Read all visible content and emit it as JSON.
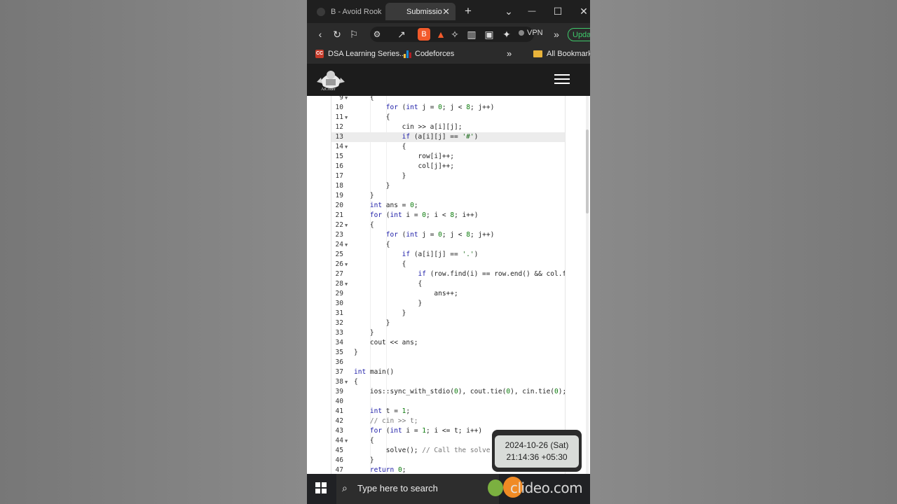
{
  "browser": {
    "tabs": [
      {
        "label": "B - Avoid Rook"
      },
      {
        "label": "Submissio"
      }
    ],
    "tab_close": "✕",
    "new_tab": "+",
    "window_controls": {
      "dropdown": "⌄",
      "minimize": "—",
      "maximize": "☐",
      "close": "✕"
    },
    "toolbar": {
      "vpn_label": "VPN",
      "update_label": "Updat",
      "more": "»"
    },
    "bookmarks": [
      {
        "label": "DSA Learning Series..."
      },
      {
        "label": "Codeforces"
      }
    ],
    "bookmarks_more": "»",
    "all_bookmarks": "All Bookmarks"
  },
  "site": {
    "logo_caption": "AtCoder"
  },
  "editor": {
    "active_line": 13,
    "lines": [
      {
        "n": "9",
        "fold": true,
        "html": "    {"
      },
      {
        "n": "10",
        "fold": false,
        "html": "        <span class='kw'>for</span> (<span class='kw'>int</span> j = <span class='num'>0</span>; j &lt; <span class='num'>8</span>; j++)"
      },
      {
        "n": "11",
        "fold": true,
        "html": "        {"
      },
      {
        "n": "12",
        "fold": false,
        "html": "            cin &gt;&gt; a[i][j];"
      },
      {
        "n": "13",
        "fold": false,
        "html": "            <span class='kw'>if</span> (a[i][j] == <span class='str'>'#'</span>)"
      },
      {
        "n": "14",
        "fold": true,
        "html": "            {"
      },
      {
        "n": "15",
        "fold": false,
        "html": "                row[i]++;"
      },
      {
        "n": "16",
        "fold": false,
        "html": "                col[j]++;"
      },
      {
        "n": "17",
        "fold": false,
        "html": "            }"
      },
      {
        "n": "18",
        "fold": false,
        "html": "        }"
      },
      {
        "n": "19",
        "fold": false,
        "html": "    }"
      },
      {
        "n": "20",
        "fold": false,
        "html": "    <span class='kw'>int</span> ans = <span class='num'>0</span>;"
      },
      {
        "n": "21",
        "fold": false,
        "html": "    <span class='kw'>for</span> (<span class='kw'>int</span> i = <span class='num'>0</span>; i &lt; <span class='num'>8</span>; i++)"
      },
      {
        "n": "22",
        "fold": true,
        "html": "    {"
      },
      {
        "n": "23",
        "fold": false,
        "html": "        <span class='kw'>for</span> (<span class='kw'>int</span> j = <span class='num'>0</span>; j &lt; <span class='num'>8</span>; j++)"
      },
      {
        "n": "24",
        "fold": true,
        "html": "        {"
      },
      {
        "n": "25",
        "fold": false,
        "html": "            <span class='kw'>if</span> (a[i][j] == <span class='str'>'.'</span>)"
      },
      {
        "n": "26",
        "fold": true,
        "html": "            {"
      },
      {
        "n": "27",
        "fold": false,
        "html": "                <span class='kw'>if</span> (row.find(i) == row.end() &amp;&amp; col.find"
      },
      {
        "n": "28",
        "fold": true,
        "html": "                {"
      },
      {
        "n": "29",
        "fold": false,
        "html": "                    ans++;"
      },
      {
        "n": "30",
        "fold": false,
        "html": "                }"
      },
      {
        "n": "31",
        "fold": false,
        "html": "            }"
      },
      {
        "n": "32",
        "fold": false,
        "html": "        }"
      },
      {
        "n": "33",
        "fold": false,
        "html": "    }"
      },
      {
        "n": "34",
        "fold": false,
        "html": "    cout &lt;&lt; ans;"
      },
      {
        "n": "35",
        "fold": false,
        "html": "}"
      },
      {
        "n": "36",
        "fold": false,
        "html": ""
      },
      {
        "n": "37",
        "fold": false,
        "html": "<span class='kw'>int</span> main()"
      },
      {
        "n": "38",
        "fold": true,
        "html": "{"
      },
      {
        "n": "39",
        "fold": false,
        "html": "    ios::sync_with_stdio(<span class='num'>0</span>), cout.tie(<span class='num'>0</span>), cin.tie(<span class='num'>0</span>);"
      },
      {
        "n": "40",
        "fold": false,
        "html": ""
      },
      {
        "n": "41",
        "fold": false,
        "html": "    <span class='kw'>int</span> t = <span class='num'>1</span>;"
      },
      {
        "n": "42",
        "fold": false,
        "html": "    <span class='cm'>// cin &gt;&gt; t;</span>"
      },
      {
        "n": "43",
        "fold": false,
        "html": "    <span class='kw'>for</span> (<span class='kw'>int</span> i = <span class='num'>1</span>; i &lt;= t; i++)"
      },
      {
        "n": "44",
        "fold": true,
        "html": "    {"
      },
      {
        "n": "45",
        "fold": false,
        "html": "        solve(); <span class='cm'>// Call the solve fu</span>"
      },
      {
        "n": "46",
        "fold": false,
        "html": "    }"
      },
      {
        "n": "47",
        "fold": false,
        "html": "    <span class='kw'>return</span> <span class='num'>0</span>;"
      }
    ]
  },
  "timestamp": {
    "date": "2024-10-26 (Sat)",
    "time": "21:14:36 +05:30"
  },
  "taskbar": {
    "search_placeholder": "Type here to search",
    "watermark": "clideo.com"
  }
}
